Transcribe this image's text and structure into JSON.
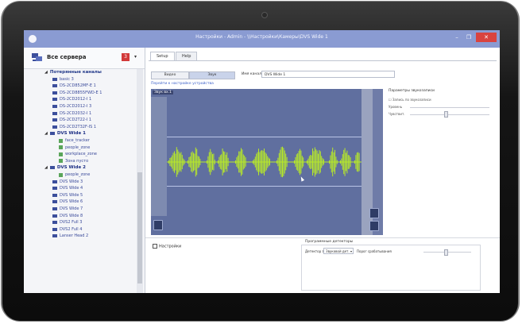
{
  "window": {
    "title": "Настройки - Admin - \\\\Настройки\\Камеры\\DVS Wide 1",
    "min_glyph": "–",
    "max_glyph": "❐",
    "close_glyph": "✕"
  },
  "sidebar": {
    "title": "Все сервера",
    "badge": "3",
    "dropdown_glyph": "▾",
    "items": [
      {
        "label": "Потерянные каналы",
        "type": "group"
      },
      {
        "label": "basic 3",
        "type": "camera"
      },
      {
        "label": "DS-2CD852MF-E 1",
        "type": "camera"
      },
      {
        "label": "DS-2CD8855FWD-E 1",
        "type": "camera"
      },
      {
        "label": "DS-2CD2012-I 1",
        "type": "camera"
      },
      {
        "label": "DS-2CD2012-I 3",
        "type": "camera"
      },
      {
        "label": "DS-2CD2032-I 1",
        "type": "camera"
      },
      {
        "label": "DS-2CD2T22-I 1",
        "type": "camera"
      },
      {
        "label": "DS-2CD2T32F-IS 1",
        "type": "camera"
      },
      {
        "label": "DVS Wide 1",
        "type": "camera-bold"
      },
      {
        "label": "face_tracker",
        "type": "zone"
      },
      {
        "label": "people_zone",
        "type": "zone"
      },
      {
        "label": "workplace_zone",
        "type": "zone"
      },
      {
        "label": "Зона пусто",
        "type": "zone"
      },
      {
        "label": "DVS Wide 2",
        "type": "camera-bold"
      },
      {
        "label": "people_zone",
        "type": "zone"
      },
      {
        "label": "DVS Wide 3",
        "type": "camera"
      },
      {
        "label": "DVS Wide 4",
        "type": "camera"
      },
      {
        "label": "DVS Wide 5",
        "type": "camera"
      },
      {
        "label": "DVS Wide 6",
        "type": "camera"
      },
      {
        "label": "DVS Wide 7",
        "type": "camera"
      },
      {
        "label": "DVS Wide 8",
        "type": "camera"
      },
      {
        "label": "DVS2 Full 3",
        "type": "camera"
      },
      {
        "label": "DVS2 Full 4",
        "type": "camera"
      },
      {
        "label": "Lanser Head 2",
        "type": "camera"
      }
    ]
  },
  "tabs": [
    {
      "label": "Setup",
      "active": true
    },
    {
      "label": "Help",
      "active": false
    }
  ],
  "toolbar": {
    "buttons": [
      "Видео",
      "Звук"
    ],
    "name_label": "Имя канала",
    "name_value": "DVS Wide 1",
    "link": "Перейти к настройке устройства"
  },
  "video": {
    "label": "Звук вх.1",
    "wave_color": "#b7e82a"
  },
  "right_panel": {
    "title": "Параметры звукозаписи",
    "check": "☐ Запись по звукозаписи",
    "row1": "Уровень",
    "row2": "Чувствит."
  },
  "bottom": {
    "check_label": "Настройки",
    "group_title": "Программные детекторы",
    "detector_label": "Детектор звука",
    "detector_value": "Звуковой дет.",
    "select_glyph": "▾",
    "compare_label": "Порог срабатывания"
  }
}
